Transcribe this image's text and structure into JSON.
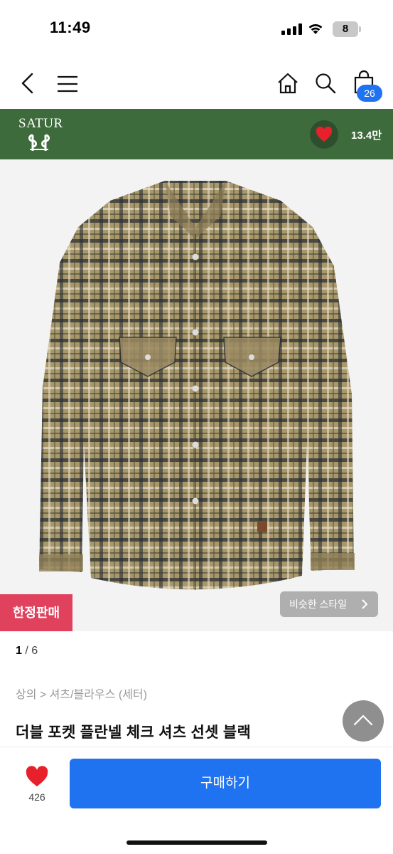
{
  "status_bar": {
    "time": "11:49",
    "battery": "8"
  },
  "brand": {
    "name": "SATUR",
    "like_count": "13.4만",
    "bar_color": "#3e6b3c"
  },
  "cart": {
    "badge_count": "26"
  },
  "product": {
    "limited_badge": "한정판매",
    "similar_style_label": "비슷한 스타일",
    "pager": {
      "current": "1",
      "separator": " / ",
      "total": "6"
    },
    "breadcrumb": "상의 > 셔츠/블라우스 (세터)",
    "title": "더블 포켓 플란넬 체크 셔츠 선셋 블랙"
  },
  "bottom_bar": {
    "wish_count": "426",
    "buy_label": "구매하기",
    "accent": "#1f73f1"
  },
  "icons": [
    "back-icon",
    "menu-icon",
    "home-icon",
    "search-icon",
    "cart-icon",
    "heart-icon",
    "chevron-right-icon",
    "chevron-up-icon"
  ]
}
